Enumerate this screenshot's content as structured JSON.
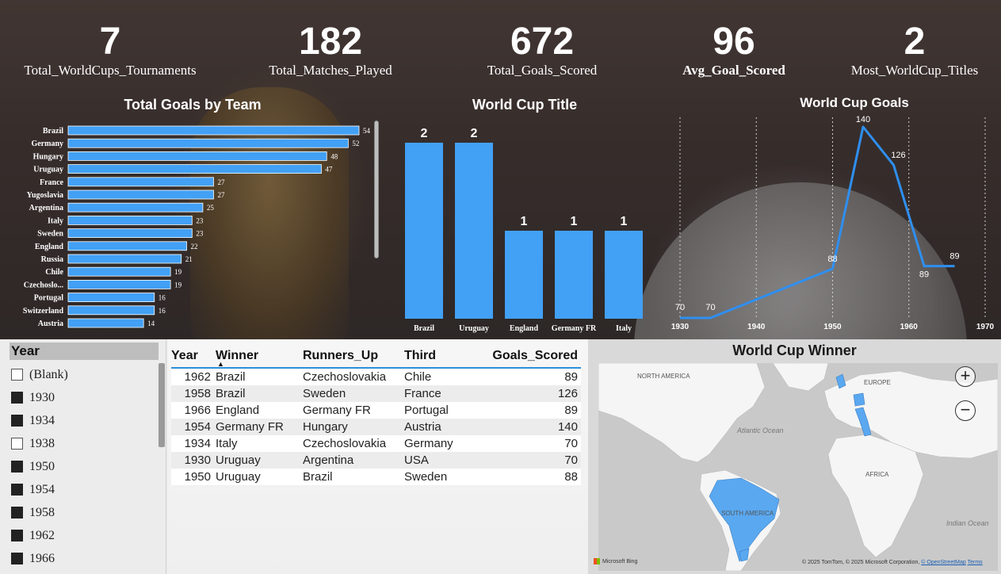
{
  "kpis": [
    {
      "value": "7",
      "label": "Total_WorldCups_Tournaments"
    },
    {
      "value": "182",
      "label": "Total_Matches_Played"
    },
    {
      "value": "672",
      "label": "Total_Goals_Scored"
    },
    {
      "value": "96",
      "label": "Avg_Goal_Scored"
    },
    {
      "value": "2",
      "label": "Most_WorldCup_Titles"
    }
  ],
  "team_goals": {
    "title": "Total Goals by Team",
    "chart_data": {
      "type": "bar",
      "orientation": "horizontal",
      "categories": [
        "Brazil",
        "Germany",
        "Hungary",
        "Uruguay",
        "France",
        "Yugoslavia",
        "Argentina",
        "Italy",
        "Sweden",
        "England",
        "Russia",
        "Chile",
        "Czechoslo...",
        "Portugal",
        "Switzerland",
        "Austria"
      ],
      "values": [
        54,
        52,
        48,
        47,
        27,
        27,
        25,
        23,
        23,
        22,
        21,
        19,
        19,
        16,
        16,
        14
      ],
      "xlim": [
        0,
        54
      ],
      "color": "#42a0f5",
      "data_labels": true
    }
  },
  "title_chart": {
    "title": "World Cup Title",
    "chart_data": {
      "type": "bar",
      "categories": [
        "Brazil",
        "Uruguay",
        "England",
        "Germany FR",
        "Italy"
      ],
      "values": [
        2,
        2,
        1,
        1,
        1
      ],
      "ylim": [
        0,
        2
      ],
      "color": "#42a0f5",
      "data_labels": true
    }
  },
  "goals_chart": {
    "title": "World Cup Goals",
    "chart_data": {
      "type": "line",
      "x": [
        1930,
        1934,
        1950,
        1954,
        1958,
        1962,
        1966
      ],
      "y": [
        70,
        70,
        88,
        140,
        126,
        89,
        89
      ],
      "xticks": [
        1930,
        1940,
        1950,
        1960,
        1970
      ],
      "xlim": [
        1930,
        1970
      ],
      "ylim": [
        70,
        140
      ],
      "color": "#2f8ff0",
      "grid": "vertical dotted",
      "data_labels": true
    }
  },
  "slicer": {
    "header": "Year",
    "items": [
      {
        "label": "(Blank)",
        "checked": false
      },
      {
        "label": "1930",
        "checked": true
      },
      {
        "label": "1934",
        "checked": true
      },
      {
        "label": "1938",
        "checked": false
      },
      {
        "label": "1950",
        "checked": true
      },
      {
        "label": "1954",
        "checked": true
      },
      {
        "label": "1958",
        "checked": true
      },
      {
        "label": "1962",
        "checked": true
      },
      {
        "label": "1966",
        "checked": true
      }
    ]
  },
  "table": {
    "columns": [
      "Year",
      "Winner",
      "Runners_Up",
      "Third",
      "Goals_Scored"
    ],
    "rows": [
      [
        "1962",
        "Brazil",
        "Czechoslovakia",
        "Chile",
        "89"
      ],
      [
        "1958",
        "Brazil",
        "Sweden",
        "France",
        "126"
      ],
      [
        "1966",
        "England",
        "Germany FR",
        "Portugal",
        "89"
      ],
      [
        "1954",
        "Germany FR",
        "Hungary",
        "Austria",
        "140"
      ],
      [
        "1934",
        "Italy",
        "Czechoslovakia",
        "Germany",
        "70"
      ],
      [
        "1930",
        "Uruguay",
        "Argentina",
        "USA",
        "70"
      ],
      [
        "1950",
        "Uruguay",
        "Brazil",
        "Sweden",
        "88"
      ]
    ]
  },
  "map": {
    "title": "World Cup Winner",
    "zoom_in": "+",
    "zoom_out": "−",
    "labels": {
      "north_america": "NORTH AMERICA",
      "europe": "EUROPE",
      "atlantic": "Atlantic Ocean",
      "africa": "AFRICA",
      "south_america": "SOUTH AMERICA",
      "indian": "Indian Ocean"
    },
    "attribution": "© 2025 TomTom, © 2025 Microsoft Corporation,",
    "osm": "© OpenStreetMap",
    "terms": "Terms",
    "logo": "Microsoft Bing",
    "highlight_color": "#5aa8f0"
  }
}
